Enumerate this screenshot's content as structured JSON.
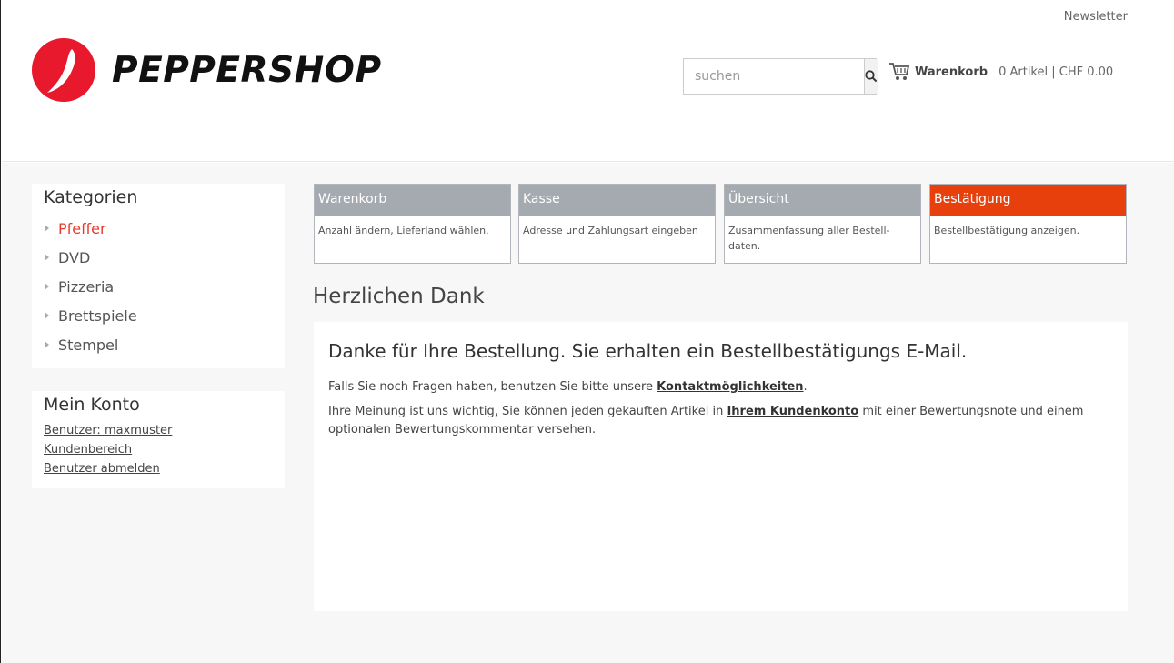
{
  "header": {
    "newsletter_label": "Newsletter",
    "logo_text": "PEPPERSHOP",
    "search_placeholder": "suchen",
    "cart_label": "Warenkorb",
    "cart_info": "0 Artikel | CHF 0.00"
  },
  "sidebar": {
    "categories_title": "Kategorien",
    "categories": [
      {
        "label": "Pfeffer",
        "active": true
      },
      {
        "label": "DVD",
        "active": false
      },
      {
        "label": "Pizzeria",
        "active": false
      },
      {
        "label": "Brettspiele",
        "active": false
      },
      {
        "label": "Stempel",
        "active": false
      }
    ],
    "account_title": "Mein Konto",
    "account_links": [
      "Benutzer: maxmuster",
      "Kundenbereich",
      "Benutzer abmelden"
    ]
  },
  "steps": [
    {
      "title": "Warenkorb",
      "desc": "Anzahl ändern, Lieferland wählen.",
      "active": false
    },
    {
      "title": "Kasse",
      "desc": "Adresse und Zahlungsart eingeben",
      "active": false
    },
    {
      "title": "Übersicht",
      "desc": "Zusammenfassung aller Bestell-daten.",
      "active": false
    },
    {
      "title": "Bestätigung",
      "desc": "Bestellbestätigung anzeigen.",
      "active": true
    }
  ],
  "main": {
    "page_title": "Herzlichen Dank",
    "heading": "Danke für Ihre Bestellung. Sie erhalten ein Bestellbestätigungs E-Mail.",
    "p1_before": "Falls Sie noch Fragen haben, benutzen Sie bitte unsere ",
    "p1_link": "Kontaktmöglichkeiten",
    "p1_after": ".",
    "p2_before": "Ihre Meinung ist uns wichtig, Sie können jeden gekauften Artikel in ",
    "p2_link": "Ihrem Kundenkonto",
    "p2_after": " mit einer Bewertungsnote und einem optionalen Bewertungskommentar versehen."
  },
  "colors": {
    "accent": "#e8400c",
    "active_category": "#e33b2e",
    "step_inactive": "#a4aab0",
    "logo_red": "#e8192c"
  }
}
